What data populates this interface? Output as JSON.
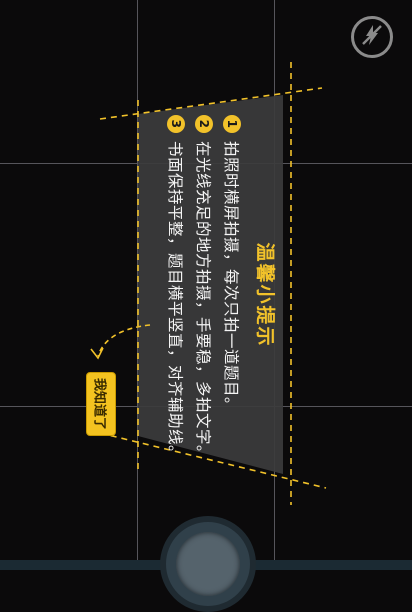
{
  "camera": {
    "flash_icon": "flash-off-icon",
    "flash_label": "闪光灯关闭"
  },
  "tips": {
    "title": "温馨小提示",
    "items": [
      {
        "num": "1",
        "text": "拍照时横屏拍摄，每次只拍一道题目。"
      },
      {
        "num": "2",
        "text": "在光线充足的地方拍摄，手要稳，多拍文字。"
      },
      {
        "num": "3",
        "text": "书面保持平整，题目横平竖直，对齐辅助线。"
      }
    ],
    "dismiss_label": "我知道了"
  },
  "colors": {
    "accent": "#f2c22a",
    "panel": "#3b3b3c",
    "background": "#0b0a0b",
    "grid": "#56555b"
  }
}
